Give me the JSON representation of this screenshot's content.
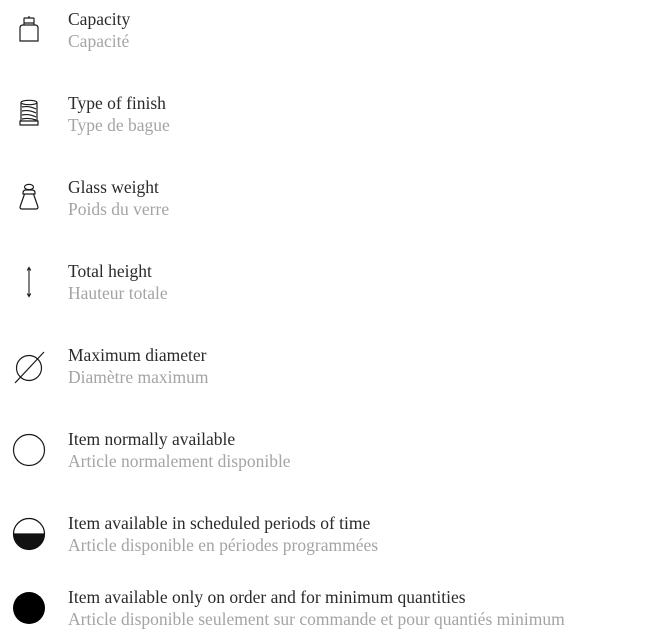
{
  "legend": {
    "items": [
      {
        "icon": "bottle-capacity-icon",
        "en": "Capacity",
        "fr": "Capacité"
      },
      {
        "icon": "finish-type-icon",
        "en": "Type of finish",
        "fr": "Type de bague"
      },
      {
        "icon": "glass-weight-icon",
        "en": "Glass weight",
        "fr": "Poids du verre"
      },
      {
        "icon": "height-arrow-icon",
        "en": "Total height",
        "fr": "Hauteur totale"
      },
      {
        "icon": "diameter-icon",
        "en": "Maximum diameter",
        "fr": "Diamètre maximum"
      },
      {
        "icon": "empty-circle-icon",
        "en": "Item normally available",
        "fr": "Article normalement disponible"
      },
      {
        "icon": "half-filled-circle-icon",
        "en": "Item available in scheduled periods of time",
        "fr": "Article disponible en périodes programmées"
      },
      {
        "icon": "filled-circle-icon",
        "en": "Item available only on order and for minimum quantities",
        "fr": "Article disponible seulement sur commande et pour quantiés minimum"
      }
    ]
  }
}
